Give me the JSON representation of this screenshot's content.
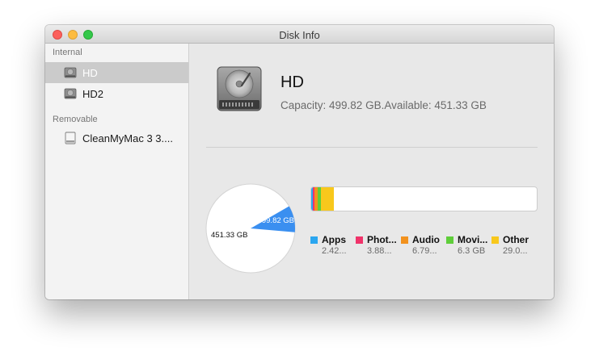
{
  "window": {
    "title": "Disk Info"
  },
  "sidebar": {
    "sections": [
      {
        "label": "Internal",
        "items": [
          {
            "label": "HD",
            "icon": "hard-drive-icon",
            "selected": true
          },
          {
            "label": "HD2",
            "icon": "hard-drive-icon",
            "selected": false
          }
        ]
      },
      {
        "label": "Removable",
        "items": [
          {
            "label": "CleanMyMac 3 3....",
            "icon": "removable-drive-icon",
            "selected": false
          }
        ]
      }
    ]
  },
  "detail": {
    "disk_name": "HD",
    "capacity_text": "Capacity: 499.82 GB.Available: 451.33 GB",
    "pie": {
      "available_label": "451.33 GB",
      "used_label": "499.82 GB",
      "used_fraction": 0.097,
      "used_color": "#3a8ff0",
      "available_color": "#ffffff"
    },
    "legend": [
      {
        "name": "Apps",
        "size": "2.42...",
        "color": "#2aa6f0"
      },
      {
        "name": "Phot...",
        "size": "3.88...",
        "color": "#f0336a"
      },
      {
        "name": "Audio",
        "size": "6.79...",
        "color": "#f2921e"
      },
      {
        "name": "Movi...",
        "size": "6.3 GB",
        "color": "#5fce3a"
      },
      {
        "name": "Other",
        "size": "29.0...",
        "color": "#f8c81c"
      }
    ],
    "usage_fractions": [
      0.006,
      0.008,
      0.014,
      0.013,
      0.058
    ]
  }
}
